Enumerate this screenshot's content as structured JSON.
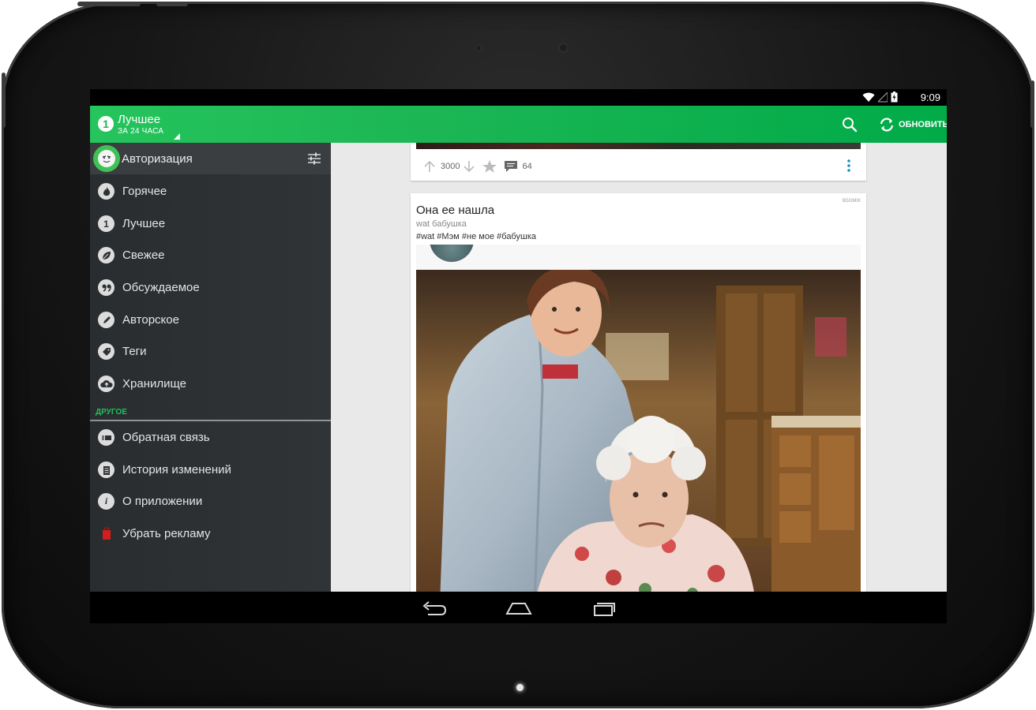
{
  "status_bar": {
    "time": "9:09"
  },
  "app_bar": {
    "title": "Лучшее",
    "subtitle": "ЗА 24 ЧАСА",
    "badge": "1",
    "refresh_label": "ОБНОВИТЬ",
    "accent": "#1cb655"
  },
  "drawer": {
    "auth_label": "Авторизация",
    "items": [
      {
        "label": "Горячее",
        "icon": "flame-icon"
      },
      {
        "label": "Лучшее",
        "icon": "number-one-icon",
        "glyph": "1"
      },
      {
        "label": "Свежее",
        "icon": "leaf-icon"
      },
      {
        "label": "Обсуждаемое",
        "icon": "quote-icon"
      },
      {
        "label": "Авторское",
        "icon": "pencil-icon"
      },
      {
        "label": "Теги",
        "icon": "tag-icon"
      },
      {
        "label": "Хранилище",
        "icon": "cloud-upload-icon"
      }
    ],
    "section_title": "ДРУГОЕ",
    "other_items": [
      {
        "label": "Обратная связь",
        "icon": "mail-icon"
      },
      {
        "label": "История изменений",
        "icon": "clipboard-icon"
      },
      {
        "label": "О приложении",
        "icon": "info-icon",
        "glyph": "i"
      },
      {
        "label": "Убрать рекламу",
        "icon": "bag-icon"
      }
    ]
  },
  "feed": {
    "prev_post": {
      "likes": "3000",
      "comments": "64"
    },
    "post": {
      "source": "9GGMIX",
      "title": "Она ее нашла",
      "subtitle": "wat бабушка",
      "tags": "#wat #Мэм #не мое #бабушка"
    }
  }
}
